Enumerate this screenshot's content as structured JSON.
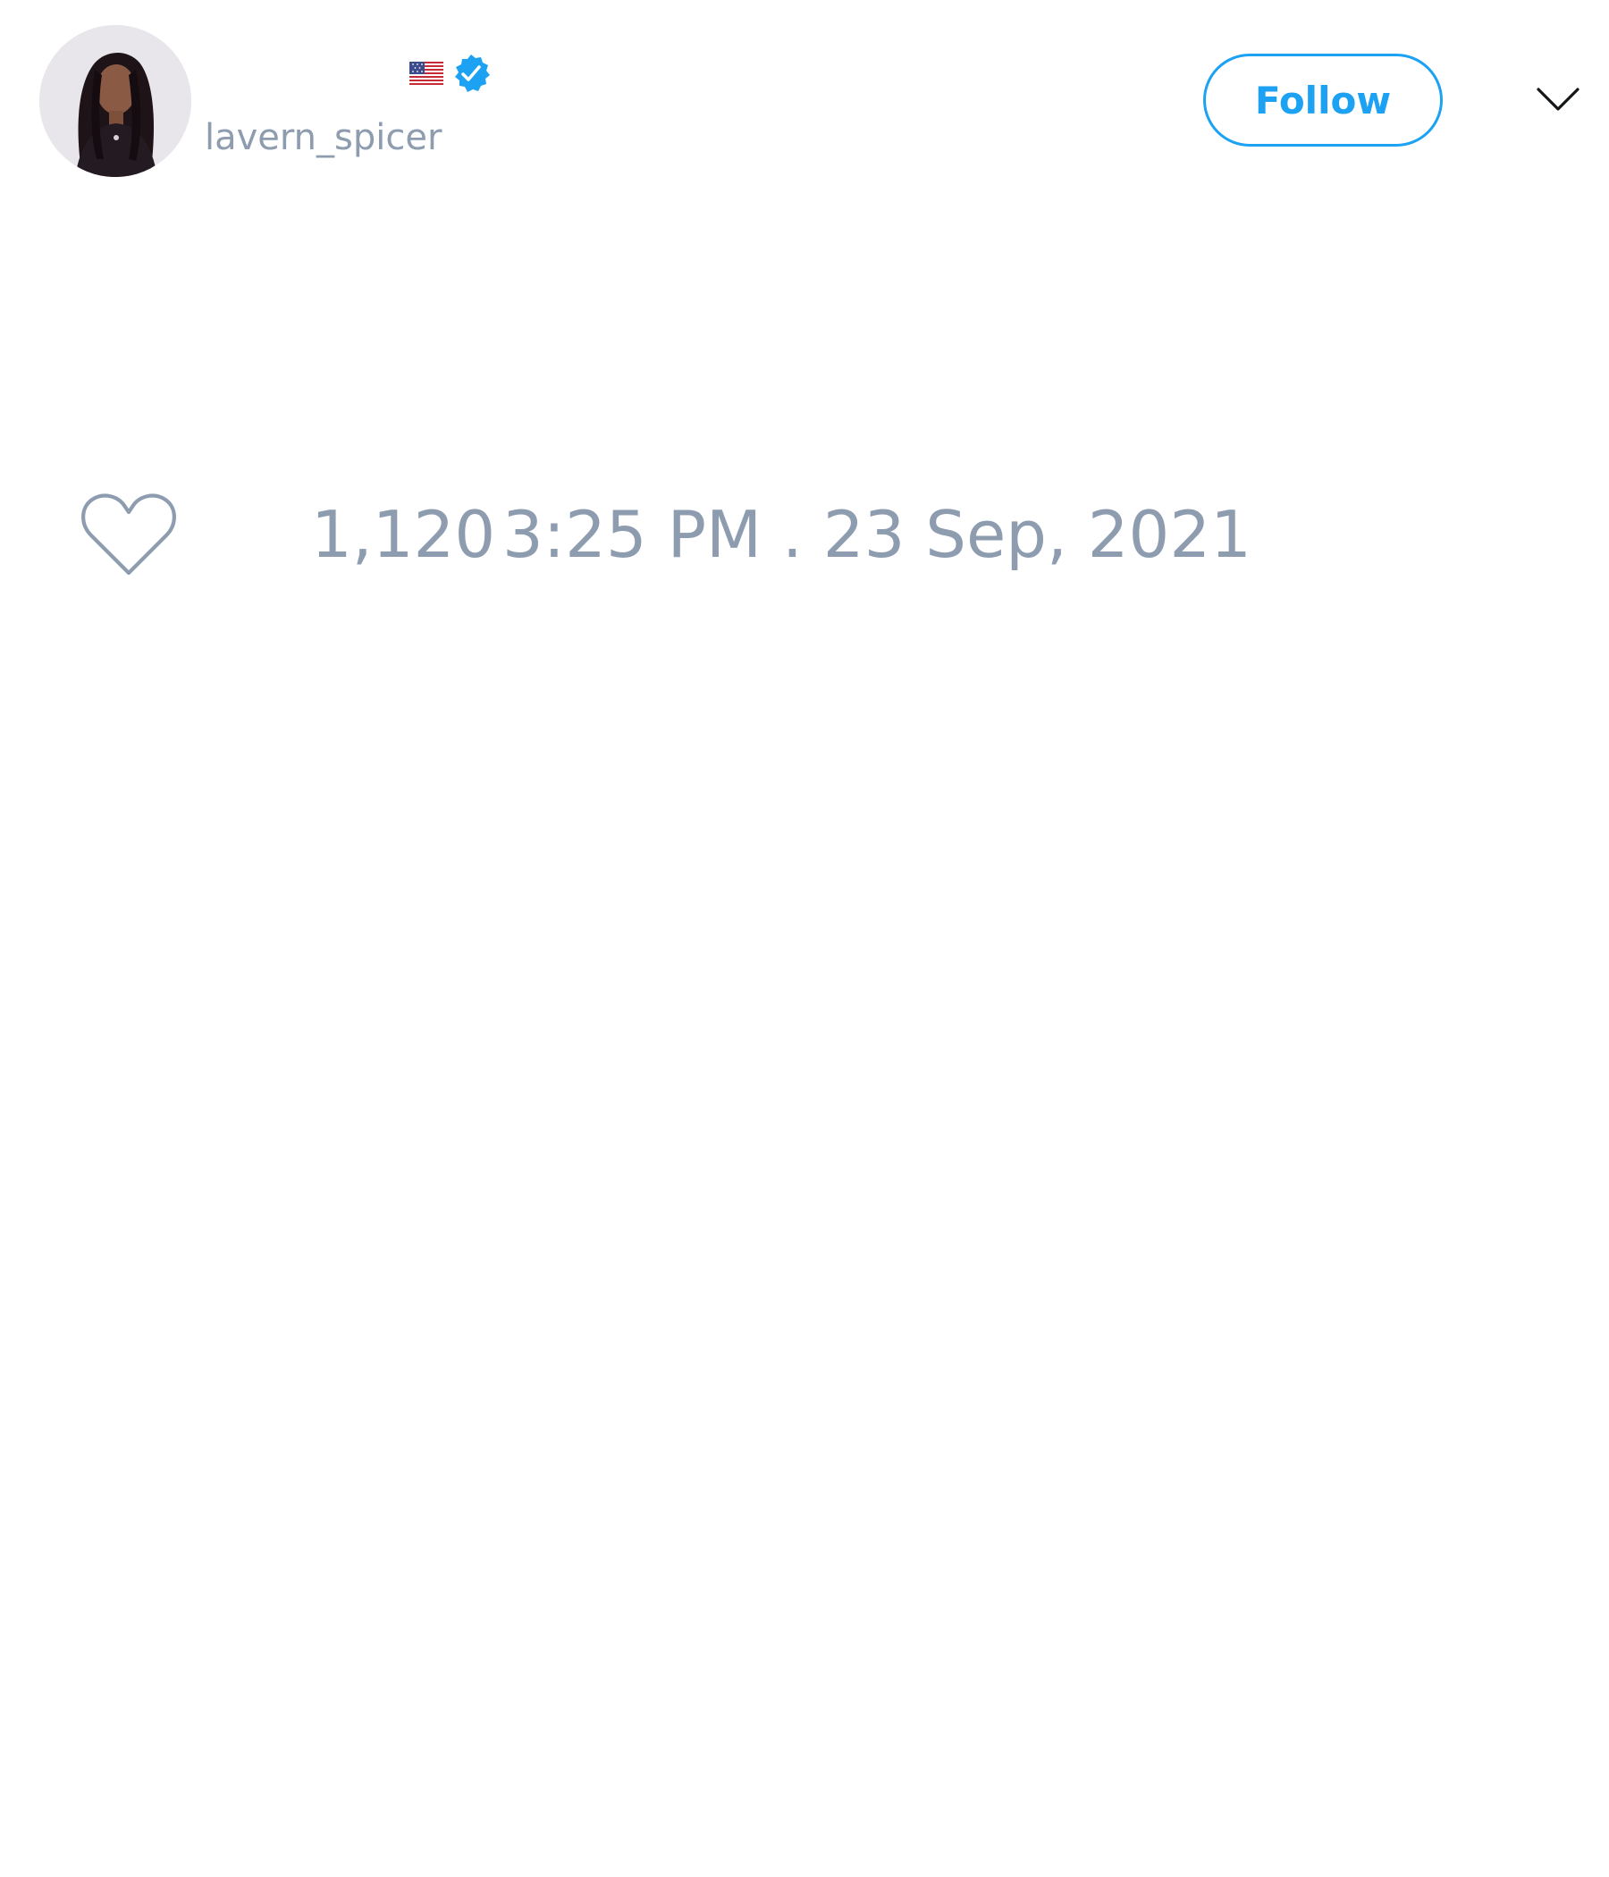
{
  "tweet": {
    "author": {
      "display_name": "",
      "handle": "lavern_spicer",
      "flag_icon": "us-flag-icon",
      "verified_icon": "verified-badge-icon",
      "verified_color": "#1da1f2"
    },
    "follow_label": "Follow",
    "menu_icon": "chevron-down-icon",
    "likes": {
      "icon": "heart-icon",
      "count": "1,120"
    },
    "timestamp": "3:25 PM . 23 Sep, 2021"
  },
  "colors": {
    "accent": "#1da1f2",
    "muted_text": "#8e9cb0",
    "background": "#ffffff"
  }
}
